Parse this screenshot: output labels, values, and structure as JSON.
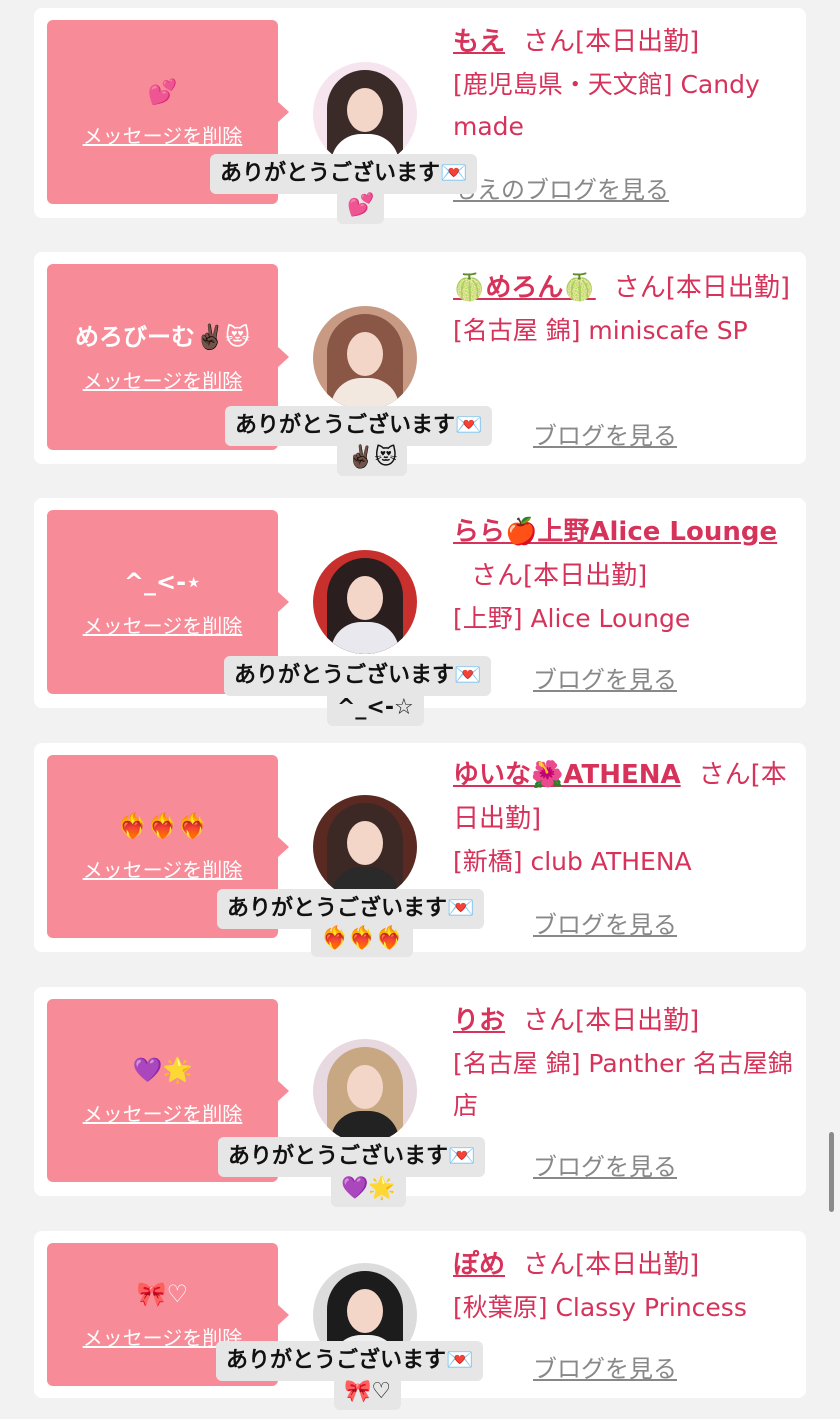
{
  "colors": {
    "accent": "#d6325a",
    "bubble": "#f78b98",
    "link_gray": "#888888",
    "reply_bg": "#e6e6e6"
  },
  "delete_label": "メッセージを削除",
  "blog_label": "ブログを見る",
  "reply_thanks": "ありがとうございます💌",
  "entries": [
    {
      "message": "💕",
      "name": "もえ",
      "suffix": "さん[本日出勤]",
      "shop": "[鹿児島県・天文館] Candy made",
      "blog_prefix": "もえのブログを見る",
      "reply_emoji": "💕",
      "avatar_icon": "avatar-photo"
    },
    {
      "message": "めろびーむ✌🏿😻",
      "name": "🍈めろん🍈",
      "suffix": "さん[本日出勤]",
      "shop": "[名古屋 錦] miniscafe SP",
      "reply_emoji": "✌🏿😻",
      "avatar_icon": "avatar-photo"
    },
    {
      "message": "^_<-⋆",
      "name": "らら🍎上野Alice Lounge",
      "suffix": "さん[本日出勤]",
      "shop": "[上野] Alice Lounge",
      "reply_emoji": "^_<-☆",
      "avatar_icon": "avatar-photo"
    },
    {
      "message": "❤️‍🔥❤️‍🔥❤️‍🔥",
      "name": "ゆいな🌺ATHENA",
      "suffix": "さん[本日出勤]",
      "shop": "[新橋] club ATHENA",
      "reply_emoji": "❤️‍🔥❤️‍🔥❤️‍🔥",
      "avatar_icon": "avatar-photo"
    },
    {
      "message": "💜🌟",
      "name": "りお",
      "suffix": "さん[本日出勤]",
      "shop": "[名古屋 錦] Panther 名古屋錦店",
      "reply_emoji": "💜🌟",
      "avatar_icon": "avatar-photo"
    },
    {
      "message": "🎀♡",
      "name": "ぽめ",
      "suffix": "さん[本日出勤]",
      "shop": "[秋葉原] Classy Princess",
      "reply_emoji": "🎀♡",
      "avatar_icon": "avatar-photo"
    }
  ]
}
